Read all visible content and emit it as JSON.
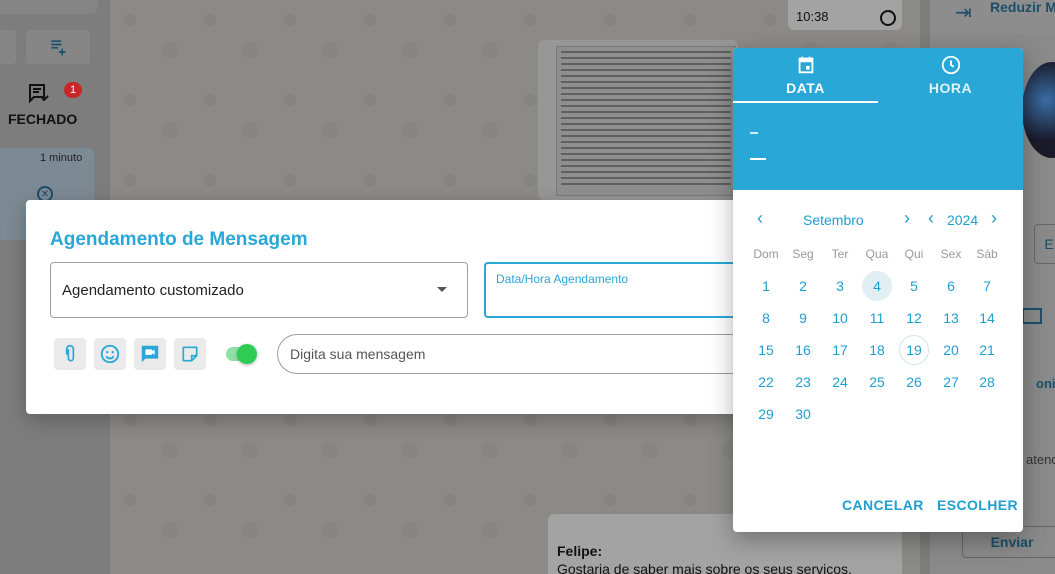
{
  "background": {
    "left_panel": {
      "fechado_label": "FECHADO",
      "fechado_badge": "1",
      "ticket_time": "1 minuto"
    },
    "chat": {
      "top_message_time": "10:38",
      "bottom_message_sender": "Felipe:",
      "bottom_message_text": "Gostaria de saber mais sobre os seus serviços."
    },
    "right_panel": {
      "reduzir_label": "Reduzir M",
      "side_button_label": "E",
      "sincroniza_label": "oniza",
      "atende_label": "atenc",
      "enviar_label": "Enviar"
    }
  },
  "modal": {
    "title": "Agendamento de Mensagem",
    "schedule_type": {
      "value": "Agendamento customizado"
    },
    "datetime_field": {
      "label": "Data/Hora Agendamento",
      "value": ""
    },
    "message_input": {
      "placeholder": "Digita sua mensagem"
    },
    "toggle": {
      "on": true,
      "color": "#2ecc55"
    }
  },
  "date_picker": {
    "tabs": [
      {
        "label": "DATA",
        "icon": "calendar-icon",
        "active": true
      },
      {
        "label": "HORA",
        "icon": "clock-icon",
        "active": false
      }
    ],
    "month": "Setembro",
    "year": "2024",
    "weekdays": [
      "Dom",
      "Seg",
      "Ter",
      "Qua",
      "Qui",
      "Sex",
      "Sáb"
    ],
    "weeks": [
      [
        "1",
        "2",
        "3",
        "4",
        "5",
        "6",
        "7"
      ],
      [
        "8",
        "9",
        "10",
        "11",
        "12",
        "13",
        "14"
      ],
      [
        "15",
        "16",
        "17",
        "18",
        "19",
        "20",
        "21"
      ],
      [
        "22",
        "23",
        "24",
        "25",
        "26",
        "27",
        "28"
      ],
      [
        "29",
        "30",
        "",
        "",
        "",
        "",
        ""
      ]
    ],
    "selected_day": "4",
    "today_day": "19",
    "cancel_label": "CANCELAR",
    "ok_label": "ESCOLHER",
    "accent_color": "#29a7d6"
  }
}
